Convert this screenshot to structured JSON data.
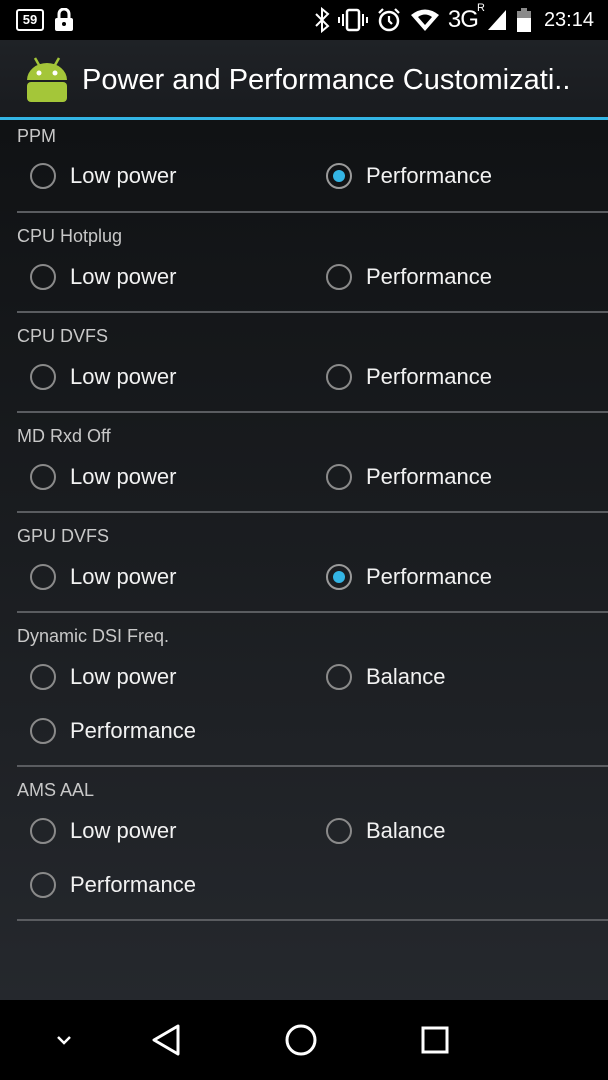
{
  "status_bar": {
    "notification_count": "59",
    "network": "3G",
    "roaming": "R",
    "time": "23:14",
    "icons": [
      "lock-icon",
      "bluetooth-icon",
      "vibrate-icon",
      "alarm-icon",
      "wifi-icon",
      "cell-signal-icon",
      "battery-icon"
    ]
  },
  "action_bar": {
    "title": "Power and Performance Customizati..",
    "icon": "android-icon"
  },
  "accent_color": "#33b5e5",
  "sections": [
    {
      "title": "PPM",
      "options": [
        "Low power",
        "Performance"
      ],
      "selected": 1
    },
    {
      "title": "CPU Hotplug",
      "options": [
        "Low power",
        "Performance"
      ],
      "selected": null
    },
    {
      "title": "CPU DVFS",
      "options": [
        "Low power",
        "Performance"
      ],
      "selected": null
    },
    {
      "title": "MD Rxd Off",
      "options": [
        "Low power",
        "Performance"
      ],
      "selected": null
    },
    {
      "title": "GPU DVFS",
      "options": [
        "Low power",
        "Performance"
      ],
      "selected": 1
    },
    {
      "title": "Dynamic DSI Freq.",
      "options": [
        "Low power",
        "Balance",
        "Performance"
      ],
      "selected": null
    },
    {
      "title": "AMS AAL",
      "options": [
        "Low power",
        "Balance",
        "Performance"
      ],
      "selected": null
    }
  ],
  "nav_bar": {
    "icons": [
      "hide-keyboard-icon",
      "back-icon",
      "home-icon",
      "recents-icon"
    ]
  }
}
